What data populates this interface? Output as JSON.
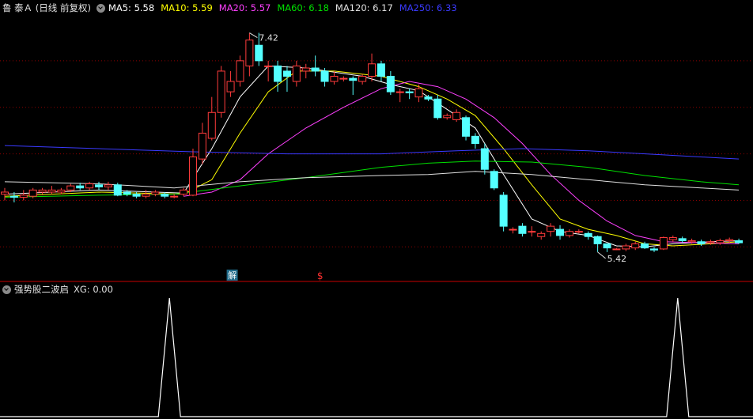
{
  "header": {
    "stock_title": "鲁 泰Ａ (日线 前复权)",
    "ma_items": [
      {
        "label": "MA5: 5.58",
        "color": "#ffffff"
      },
      {
        "label": "MA10: 5.59",
        "color": "#ffff00"
      },
      {
        "label": "MA20: 5.57",
        "color": "#ff40ff"
      },
      {
        "label": "MA60: 6.18",
        "color": "#00e000"
      },
      {
        "label": "MA120: 6.17",
        "color": "#e0e0e0"
      },
      {
        "label": "MA250: 6.33",
        "color": "#3a3aff"
      }
    ]
  },
  "indicator_header": {
    "title": "强势股二波启",
    "value": "XG: 0.00"
  },
  "annotations": {
    "high_label": "7.42",
    "low_label": "5.42",
    "marker_jie": "解",
    "marker_s": "$"
  },
  "colors": {
    "up": "#ff3b3b",
    "down": "#54ffff",
    "background": "#000000",
    "divider": "#a00000",
    "grid": "#8b0000"
  },
  "chart_data": {
    "type": "candlestick",
    "price_range": [
      5.1,
      7.6
    ],
    "candles": [
      [
        5.86,
        5.88,
        5.92,
        5.8
      ],
      [
        5.84,
        5.83,
        5.88,
        5.78
      ],
      [
        5.83,
        5.85,
        5.9,
        5.8
      ],
      [
        5.84,
        5.9,
        5.92,
        5.82
      ],
      [
        5.88,
        5.9,
        5.92,
        5.86
      ],
      [
        5.88,
        5.9,
        5.94,
        5.86
      ],
      [
        5.88,
        5.9,
        5.92,
        5.86
      ],
      [
        5.9,
        5.94,
        5.96,
        5.88
      ],
      [
        5.94,
        5.92,
        5.97,
        5.9
      ],
      [
        5.92,
        5.96,
        5.98,
        5.9
      ],
      [
        5.95,
        5.93,
        5.98,
        5.9
      ],
      [
        5.93,
        5.95,
        5.98,
        5.9
      ],
      [
        5.95,
        5.85,
        5.97,
        5.84
      ],
      [
        5.88,
        5.86,
        5.9,
        5.84
      ],
      [
        5.86,
        5.84,
        5.88,
        5.82
      ],
      [
        5.84,
        5.86,
        5.9,
        5.82
      ],
      [
        5.86,
        5.88,
        5.9,
        5.84
      ],
      [
        5.86,
        5.84,
        5.88,
        5.82
      ],
      [
        5.84,
        5.84,
        5.86,
        5.82
      ],
      [
        5.86,
        5.9,
        5.92,
        5.84
      ],
      [
        5.85,
        6.22,
        6.3,
        5.84
      ],
      [
        6.2,
        6.45,
        6.55,
        6.15
      ],
      [
        6.4,
        6.65,
        6.8,
        6.38
      ],
      [
        6.65,
        7.05,
        7.1,
        6.6
      ],
      [
        6.85,
        6.95,
        7.05,
        6.8
      ],
      [
        6.95,
        7.15,
        7.2,
        6.9
      ],
      [
        7.1,
        7.35,
        7.42,
        7.0
      ],
      [
        7.3,
        7.15,
        7.42,
        7.1
      ],
      [
        7.1,
        7.1,
        7.15,
        6.95
      ],
      [
        7.1,
        6.95,
        7.15,
        6.85
      ],
      [
        7.05,
        7.0,
        7.1,
        6.85
      ],
      [
        6.95,
        7.1,
        7.15,
        6.9
      ],
      [
        7.05,
        7.08,
        7.12,
        6.98
      ],
      [
        7.08,
        7.05,
        7.2,
        7.0
      ],
      [
        7.05,
        6.95,
        7.08,
        6.9
      ],
      [
        6.95,
        7.0,
        7.05,
        6.92
      ],
      [
        6.98,
        6.98,
        7.0,
        6.95
      ],
      [
        6.98,
        6.96,
        7.0,
        6.82
      ],
      [
        6.95,
        7.0,
        7.02,
        6.92
      ],
      [
        7.0,
        7.12,
        7.22,
        6.95
      ],
      [
        7.12,
        7.0,
        7.15,
        6.95
      ],
      [
        7.0,
        6.85,
        7.05,
        6.82
      ],
      [
        6.85,
        6.85,
        6.88,
        6.75
      ],
      [
        6.85,
        6.84,
        6.88,
        6.78
      ],
      [
        6.8,
        6.88,
        6.92,
        6.75
      ],
      [
        6.8,
        6.78,
        6.82,
        6.76
      ],
      [
        6.78,
        6.6,
        6.82,
        6.58
      ],
      [
        6.6,
        6.62,
        6.64,
        6.58
      ],
      [
        6.58,
        6.65,
        6.68,
        6.56
      ],
      [
        6.6,
        6.42,
        6.62,
        6.38
      ],
      [
        6.42,
        6.35,
        6.45,
        6.3
      ],
      [
        6.3,
        6.1,
        6.35,
        6.05
      ],
      [
        6.08,
        5.92,
        6.1,
        5.9
      ],
      [
        5.85,
        5.55,
        5.88,
        5.5
      ],
      [
        5.52,
        5.52,
        5.54,
        5.48
      ],
      [
        5.55,
        5.48,
        5.58,
        5.45
      ],
      [
        5.5,
        5.5,
        5.55,
        5.45
      ],
      [
        5.45,
        5.48,
        5.5,
        5.42
      ],
      [
        5.5,
        5.55,
        5.58,
        5.45
      ],
      [
        5.52,
        5.46,
        5.56,
        5.42
      ],
      [
        5.46,
        5.5,
        5.52,
        5.44
      ],
      [
        5.5,
        5.5,
        5.52,
        5.48
      ],
      [
        5.48,
        5.45,
        5.5,
        5.42
      ],
      [
        5.45,
        5.38,
        5.46,
        5.3
      ],
      [
        5.38,
        5.34,
        5.38,
        5.3
      ],
      [
        5.33,
        5.33,
        5.34,
        5.32
      ],
      [
        5.33,
        5.36,
        5.38,
        5.31
      ],
      [
        5.34,
        5.38,
        5.4,
        5.32
      ],
      [
        5.38,
        5.34,
        5.4,
        5.33
      ],
      [
        5.33,
        5.32,
        5.35,
        5.3
      ],
      [
        5.33,
        5.44,
        5.45,
        5.32
      ],
      [
        5.42,
        5.44,
        5.46,
        5.4
      ],
      [
        5.43,
        5.41,
        5.45,
        5.39
      ],
      [
        5.4,
        5.41,
        5.43,
        5.38
      ],
      [
        5.4,
        5.38,
        5.42,
        5.36
      ],
      [
        5.39,
        5.4,
        5.42,
        5.37
      ],
      [
        5.39,
        5.41,
        5.43,
        5.37
      ],
      [
        5.41,
        5.42,
        5.44,
        5.39
      ],
      [
        5.41,
        5.39,
        5.43,
        5.38
      ]
    ],
    "moving_averages": [
      {
        "name": "MA5",
        "color": "#ffffff",
        "points": [
          [
            0,
            5.86
          ],
          [
            10,
            5.9
          ],
          [
            19,
            5.87
          ],
          [
            22,
            6.3
          ],
          [
            25,
            6.8
          ],
          [
            28,
            7.1
          ],
          [
            32,
            7.08
          ],
          [
            38,
            7.0
          ],
          [
            41,
            6.92
          ],
          [
            44,
            6.86
          ],
          [
            47,
            6.68
          ],
          [
            50,
            6.5
          ],
          [
            53,
            6.05
          ],
          [
            56,
            5.62
          ],
          [
            59,
            5.5
          ],
          [
            62,
            5.46
          ],
          [
            65,
            5.36
          ],
          [
            68,
            5.35
          ],
          [
            71,
            5.38
          ],
          [
            75,
            5.4
          ],
          [
            78,
            5.41
          ]
        ]
      },
      {
        "name": "MA10",
        "color": "#ffff00",
        "points": [
          [
            0,
            5.84
          ],
          [
            10,
            5.88
          ],
          [
            19,
            5.86
          ],
          [
            22,
            6.0
          ],
          [
            25,
            6.45
          ],
          [
            28,
            6.85
          ],
          [
            31,
            7.05
          ],
          [
            35,
            7.05
          ],
          [
            40,
            7.0
          ],
          [
            44,
            6.9
          ],
          [
            47,
            6.78
          ],
          [
            50,
            6.62
          ],
          [
            53,
            6.3
          ],
          [
            56,
            5.95
          ],
          [
            59,
            5.62
          ],
          [
            62,
            5.52
          ],
          [
            65,
            5.46
          ],
          [
            68,
            5.38
          ],
          [
            71,
            5.36
          ],
          [
            75,
            5.38
          ],
          [
            78,
            5.4
          ]
        ]
      },
      {
        "name": "MA20",
        "color": "#ff40ff",
        "points": [
          [
            19,
            5.84
          ],
          [
            22,
            5.88
          ],
          [
            25,
            6.0
          ],
          [
            28,
            6.25
          ],
          [
            32,
            6.5
          ],
          [
            36,
            6.7
          ],
          [
            40,
            6.88
          ],
          [
            43,
            6.95
          ],
          [
            46,
            6.9
          ],
          [
            49,
            6.78
          ],
          [
            52,
            6.6
          ],
          [
            55,
            6.35
          ],
          [
            58,
            6.05
          ],
          [
            61,
            5.8
          ],
          [
            64,
            5.6
          ],
          [
            67,
            5.46
          ],
          [
            70,
            5.4
          ],
          [
            74,
            5.39
          ],
          [
            78,
            5.38
          ]
        ]
      },
      {
        "name": "MA60",
        "color": "#00e000",
        "points": [
          [
            0,
            5.83
          ],
          [
            10,
            5.85
          ],
          [
            18,
            5.86
          ],
          [
            25,
            5.94
          ],
          [
            32,
            6.02
          ],
          [
            40,
            6.12
          ],
          [
            45,
            6.16
          ],
          [
            50,
            6.18
          ],
          [
            56,
            6.17
          ],
          [
            62,
            6.12
          ],
          [
            68,
            6.04
          ],
          [
            74,
            5.98
          ],
          [
            78,
            5.95
          ]
        ]
      },
      {
        "name": "MA120",
        "color": "#e0e0e0",
        "points": [
          [
            0,
            5.98
          ],
          [
            10,
            5.96
          ],
          [
            18,
            5.92
          ],
          [
            25,
            5.98
          ],
          [
            32,
            6.02
          ],
          [
            40,
            6.04
          ],
          [
            45,
            6.05
          ],
          [
            50,
            6.08
          ],
          [
            56,
            6.05
          ],
          [
            62,
            6.0
          ],
          [
            68,
            5.95
          ],
          [
            74,
            5.92
          ],
          [
            78,
            5.9
          ]
        ]
      },
      {
        "name": "MA250",
        "color": "#3a3aff",
        "points": [
          [
            0,
            6.33
          ],
          [
            10,
            6.3
          ],
          [
            20,
            6.27
          ],
          [
            30,
            6.25
          ],
          [
            40,
            6.25
          ],
          [
            48,
            6.28
          ],
          [
            55,
            6.3
          ],
          [
            62,
            6.28
          ],
          [
            70,
            6.24
          ],
          [
            78,
            6.2
          ]
        ]
      }
    ],
    "xg_signal": {
      "length": 79,
      "spikes_at": [
        17,
        71
      ]
    }
  }
}
